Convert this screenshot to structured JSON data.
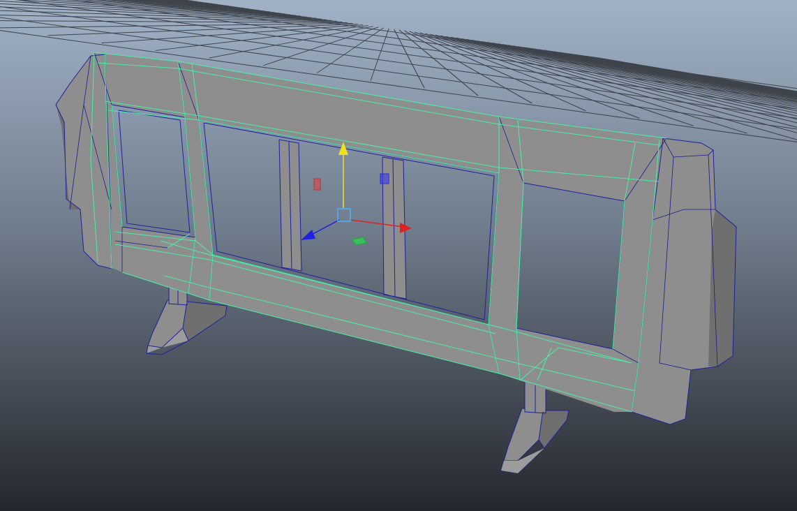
{
  "viewport": {
    "panel": "3d-perspective-viewport",
    "background_top": "#a1b2c7",
    "background_bottom": "#24272d",
    "grid_color": "#3f444c",
    "selection_highlight_color": "#49f0a6",
    "wireframe_color": "#1f1f9c",
    "mesh_color": "#8e8e8e"
  },
  "scene": {
    "object": "barrier",
    "selected": true,
    "display_mode": "shaded-with-wireframe"
  },
  "manipulator": {
    "tool": "move-tool",
    "axes": [
      {
        "axis": "x",
        "color": "#e02020"
      },
      {
        "axis": "y",
        "color": "#f0e020"
      },
      {
        "axis": "z",
        "color": "#2020e0"
      }
    ],
    "plane_handles": [
      {
        "plane": "xy",
        "color": "#3a3af0"
      },
      {
        "plane": "yz",
        "color": "#e04040"
      },
      {
        "plane": "xz",
        "color": "#30d050"
      }
    ],
    "center_color": "#4ab0ff"
  }
}
